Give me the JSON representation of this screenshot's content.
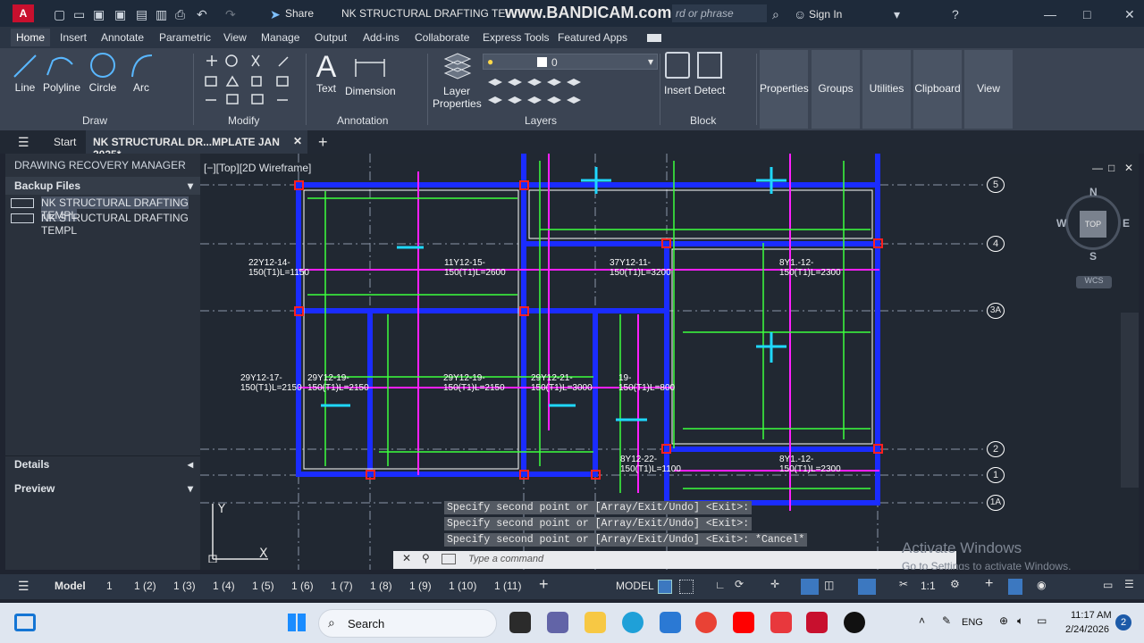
{
  "title_bar": {
    "share": "Share",
    "document_title": "NK STRUCTURAL DRAFTING TE",
    "watermark": "www.BANDICAM.com",
    "search_placeholder": "rd or phrase",
    "sign_in": "Sign In"
  },
  "ribbon_tabs": [
    "Home",
    "Insert",
    "Annotate",
    "Parametric",
    "View",
    "Manage",
    "Output",
    "Add-ins",
    "Collaborate",
    "Express Tools",
    "Featured Apps"
  ],
  "ribbon": {
    "draw_tools": [
      "Line",
      "Polyline",
      "Circle",
      "Arc"
    ],
    "draw_label": "Draw",
    "modify_label": "Modify",
    "annotation_tools": [
      "Text",
      "Dimension"
    ],
    "annotation_label": "Annotation",
    "layer_properties": "Layer Properties",
    "layer_value": "0",
    "layers_label": "Layers",
    "block_tools": [
      "Insert",
      "Detect"
    ],
    "block_label": "Block",
    "big_buttons": [
      "Properties",
      "Groups",
      "Utilities",
      "Clipboard",
      "View"
    ]
  },
  "doc_tabs": {
    "start": "Start",
    "current": "NK STRUCTURAL DR...MPLATE JAN 2025*"
  },
  "left_panel": {
    "title": "DRAWING RECOVERY MANAGER",
    "backup_files": "Backup Files",
    "files": [
      "NK STRUCTURAL DRAFTING TEMPL",
      "NK STRUCTURAL DRAFTING TEMPL"
    ],
    "details": "Details",
    "preview": "Preview"
  },
  "viewport": {
    "label": "[−][Top][2D Wireframe]",
    "grid_bubbles": [
      "5",
      "4",
      "3A",
      "2",
      "1",
      "1A"
    ],
    "viewcube": {
      "n": "N",
      "s": "S",
      "e": "E",
      "w": "W",
      "top": "TOP",
      "wcs": "WCS"
    },
    "annotations": [
      "22Y12-14-150(T1)L=1150",
      "11Y12-15-150(T1)L=2600",
      "37Y12-11-150(T1)L=3200",
      "8Y1.-12-150(T1)L=2300",
      "29Y12-17-150(T1)L=2150",
      "29Y12-19-150(T1)L=2150",
      "29Y12-19-150(T1)L=2150",
      "29Y12-21-150(T1)L=3000",
      "19-150(T1)L=800",
      "8Y12-22-150(T1)L=1100",
      "8Y1.-12-150(T1)L=2300"
    ]
  },
  "command": {
    "lines": [
      "Specify second point or [Array/Exit/Undo] <Exit>:",
      "Specify second point or [Array/Exit/Undo] <Exit>:",
      "Specify second point or [Array/Exit/Undo] <Exit>: *Cancel*"
    ],
    "placeholder": "Type a command"
  },
  "activate": {
    "title": "Activate Windows",
    "sub": "Go to Settings to activate Windows."
  },
  "status_bar": {
    "layout_tabs": [
      "Model",
      "1",
      "1 (2)",
      "1 (3)",
      "1 (4)",
      "1 (5)",
      "1 (6)",
      "1 (7)",
      "1 (8)",
      "1 (9)",
      "1 (10)",
      "1 (11)"
    ],
    "model": "MODEL",
    "scale": "1:1"
  },
  "taskbar": {
    "search": "Search",
    "lang": "ENG",
    "time": "11:17 AM",
    "date": "2/24/2026",
    "badge": "2"
  },
  "colors": {
    "blue_beam": "#1a2cff",
    "magenta": "#ff1fff",
    "green": "#3cff3c",
    "cyan": "#1fd8ff",
    "red": "#ff2020"
  }
}
